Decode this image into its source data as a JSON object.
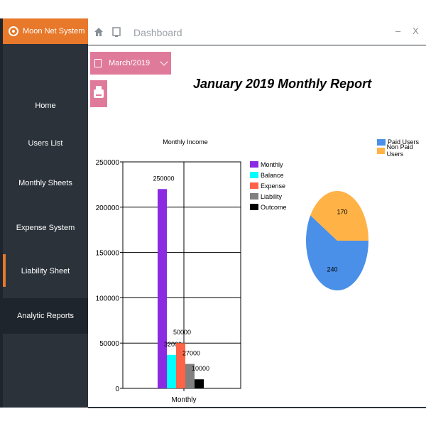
{
  "app": {
    "name": "Moon Net System"
  },
  "header": {
    "title": "Dashboard",
    "minimize": "–",
    "close": "X"
  },
  "sidebar": {
    "items": [
      {
        "label": "Home"
      },
      {
        "label": "Users List"
      },
      {
        "label": "Monthly Sheets"
      },
      {
        "label": "Expense System"
      },
      {
        "label": "Liability Sheet"
      },
      {
        "label": "Analytic Reports"
      }
    ]
  },
  "date_picker": {
    "value": "March/2019"
  },
  "report": {
    "title": "January 2019 Monthly Report"
  },
  "colors": {
    "accent": "#e8782a",
    "sidebar": "#2b323a",
    "pink": "#e07a9b",
    "monthly": "#8a2be2",
    "balance": "#00ffff",
    "expense": "#ff6347",
    "liability": "#808080",
    "outcome": "#000000",
    "paid": "#4a8fe8",
    "nonpaid": "#ffb347"
  },
  "chart_data": [
    {
      "type": "bar",
      "title": "Monthly Income",
      "categories": [
        "Monthly"
      ],
      "series": [
        {
          "name": "Monthly",
          "values": [
            220000
          ],
          "label": "250000"
        },
        {
          "name": "Balance",
          "values": [
            37000
          ],
          "label": "32000"
        },
        {
          "name": "Expense",
          "values": [
            50000
          ],
          "label": "50000"
        },
        {
          "name": "Liability",
          "values": [
            27000
          ],
          "label": "27000"
        },
        {
          "name": "Outcome",
          "values": [
            10000
          ],
          "label": "10000"
        }
      ],
      "ylim": [
        0,
        250000
      ],
      "yticks": [
        "0",
        "50000",
        "100000",
        "150000",
        "200000",
        "250000"
      ],
      "grid": true,
      "legend": "right"
    },
    {
      "type": "pie",
      "labels": [
        "Paid Users",
        "Non Paid Users"
      ],
      "values": [
        240,
        170
      ],
      "legend": "top-right"
    }
  ]
}
